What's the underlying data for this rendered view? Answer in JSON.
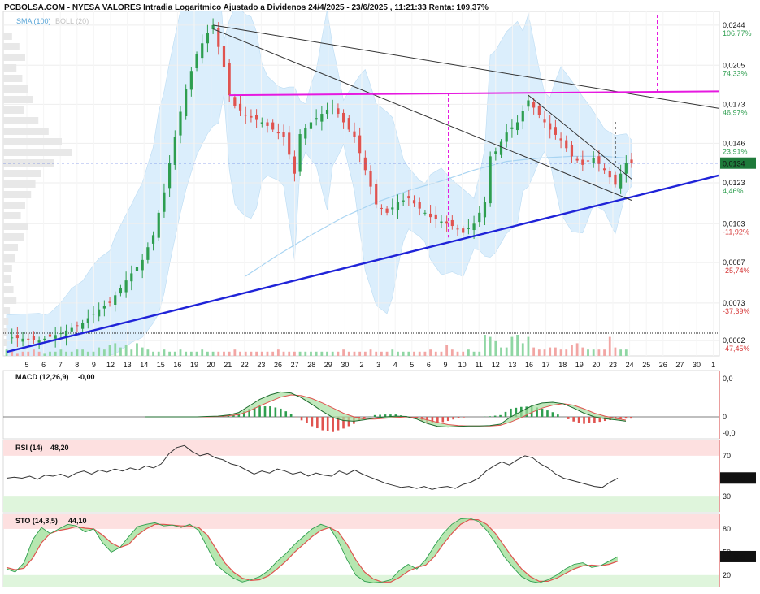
{
  "header": {
    "title": "PCBOLSA.COM - NYESA VALORES Intradia Logaritmico Ajustado a Dividenos 24/4/2025 - 23/6/2025 , 11:21:33 Renta: 109,37%",
    "indicator_sma": "SMA (100)",
    "indicator_boll": "BOLL (20)"
  },
  "colors": {
    "up": "#2e9e4f",
    "down": "#e0534f",
    "bollinger": "#cfe8fb",
    "sma": "#a8d4f2",
    "trend_blue": "#1f23d8",
    "magenta": "#e619e0",
    "last_price_box": "#1e7a3a"
  },
  "chart_data": [
    {
      "type": "line",
      "panel": "price",
      "scale": "log",
      "ylim": [
        0.0058,
        0.0259
      ],
      "y_ticks": [
        "0,0244",
        "0,0205",
        "0,0173",
        "0,0146",
        "0,0123",
        "0,0103",
        "0,0087",
        "0,0073",
        "0,0062"
      ],
      "y_tick_values": [
        0.0244,
        0.0205,
        0.0173,
        0.0146,
        0.0123,
        0.0103,
        0.0087,
        0.0073,
        0.0062
      ],
      "y_pct": [
        "106,77%",
        "74,33%",
        "46,97%",
        "23,91%",
        "4,46%",
        "-11,92%",
        "-25,74%",
        "-37,39%",
        "-47,45%"
      ],
      "last_value_label": "0,0134",
      "x_labels": [
        "5",
        "6",
        "7",
        "8",
        "9",
        "12",
        "13",
        "14",
        "15",
        "16",
        "19",
        "20",
        "21",
        "22",
        "23",
        "26",
        "27",
        "28",
        "29",
        "30",
        "2",
        "3",
        "4",
        "5",
        "6",
        "9",
        "10",
        "11",
        "12",
        "13",
        "16",
        "17",
        "18",
        "19",
        "20",
        "23",
        "24",
        "25",
        "26",
        "27",
        "30",
        "1"
      ],
      "close_path": [
        [
          0,
          0.0063
        ],
        [
          6,
          0.0062
        ],
        [
          10,
          0.0064
        ],
        [
          14,
          0.0067
        ],
        [
          17,
          0.0071
        ],
        [
          19,
          0.0073
        ],
        [
          21,
          0.0078
        ],
        [
          23,
          0.0083
        ],
        [
          25,
          0.0088
        ],
        [
          27,
          0.0098
        ],
        [
          29,
          0.0118
        ],
        [
          31,
          0.015
        ],
        [
          33,
          0.0185
        ],
        [
          35,
          0.0215
        ],
        [
          37,
          0.0236
        ],
        [
          38,
          0.0244
        ],
        [
          39,
          0.0222
        ],
        [
          40,
          0.0203
        ],
        [
          41,
          0.018
        ],
        [
          42,
          0.0172
        ],
        [
          44,
          0.0165
        ],
        [
          47,
          0.016
        ],
        [
          49,
          0.0155
        ],
        [
          51,
          0.015
        ],
        [
          53,
          0.0128
        ],
        [
          54,
          0.0152
        ],
        [
          56,
          0.016
        ],
        [
          58,
          0.0166
        ],
        [
          60,
          0.0172
        ],
        [
          62,
          0.016
        ],
        [
          64,
          0.015
        ],
        [
          66,
          0.013
        ],
        [
          68,
          0.0112
        ],
        [
          70,
          0.0108
        ],
        [
          72,
          0.0113
        ],
        [
          74,
          0.0115
        ],
        [
          76,
          0.011
        ],
        [
          78,
          0.0106
        ],
        [
          80,
          0.0104
        ],
        [
          82,
          0.0102
        ],
        [
          84,
          0.0099
        ],
        [
          86,
          0.0103
        ],
        [
          88,
          0.0113
        ],
        [
          89,
          0.0138
        ],
        [
          90,
          0.0141
        ],
        [
          92,
          0.0153
        ],
        [
          94,
          0.016
        ],
        [
          96,
          0.0176
        ],
        [
          98,
          0.0165
        ],
        [
          100,
          0.0155
        ],
        [
          102,
          0.0148
        ],
        [
          104,
          0.0138
        ],
        [
          106,
          0.0133
        ],
        [
          108,
          0.0137
        ],
        [
          110,
          0.013
        ],
        [
          112,
          0.0122
        ],
        [
          113,
          0.0128
        ],
        [
          114,
          0.0134
        ]
      ],
      "sma_100": [
        [
          44,
          0.0082
        ],
        [
          50,
          0.009
        ],
        [
          56,
          0.0098
        ],
        [
          62,
          0.0106
        ],
        [
          68,
          0.0113
        ],
        [
          74,
          0.0119
        ],
        [
          80,
          0.0124
        ],
        [
          86,
          0.013
        ],
        [
          92,
          0.0135
        ],
        [
          98,
          0.0137
        ],
        [
          104,
          0.0138
        ],
        [
          110,
          0.0138
        ],
        [
          114,
          0.0137
        ]
      ],
      "volume": [
        3,
        2,
        1,
        2,
        2,
        3,
        2,
        1,
        2,
        2,
        3,
        2,
        2,
        3,
        3,
        2,
        2,
        4,
        3,
        5,
        6,
        4,
        5,
        3,
        6,
        4,
        3,
        2,
        2,
        3,
        2,
        2,
        3,
        2,
        2,
        2,
        3,
        2,
        2,
        2,
        2,
        2,
        3,
        2,
        2,
        2,
        2,
        2,
        2,
        2,
        3,
        2,
        2,
        2,
        2,
        2,
        2,
        2,
        2,
        2,
        2,
        2,
        3,
        2,
        2,
        2,
        2,
        3,
        2,
        2,
        2,
        3,
        2,
        2,
        2,
        2,
        2,
        2,
        3,
        2,
        2,
        5,
        3,
        2,
        2,
        3,
        2,
        2,
        10,
        9,
        7,
        4,
        4,
        9,
        10,
        6,
        9,
        4,
        3,
        3,
        4,
        4,
        3,
        3,
        5,
        6,
        4,
        3,
        3,
        3,
        3,
        9,
        4,
        3,
        3
      ],
      "trendlines": [
        {
          "name": "support",
          "color": "#1f23d8",
          "from": [
            0,
            0.0059
          ],
          "to": [
            131,
            0.0127
          ]
        },
        {
          "name": "resistance",
          "color": "#333333",
          "from": [
            38,
            0.0244
          ],
          "to": [
            131,
            0.017
          ]
        },
        {
          "name": "channel-top",
          "color": "#333333",
          "from": [
            38,
            0.024
          ],
          "to": [
            115,
            0.0114
          ]
        },
        {
          "name": "channel-bottom",
          "color": "#333333",
          "from": [
            96,
            0.018
          ],
          "to": [
            115,
            0.0125
          ]
        },
        {
          "name": "horizontal-magenta",
          "color": "#e619e0",
          "from": [
            41,
            0.018
          ],
          "to": [
            131,
            0.0183
          ]
        }
      ]
    },
    {
      "type": "line",
      "panel": "macd",
      "title": "MACD (12,26,9)",
      "value": "-0,00",
      "y_ticks": [
        "0,0",
        "0",
        "-0,0"
      ],
      "macd": [
        0.0,
        0.0,
        0.0,
        0.0,
        0.0,
        0.0,
        0.01,
        0.02,
        0.05,
        0.12,
        0.3,
        0.48,
        0.6,
        0.68,
        0.65,
        0.52,
        0.34,
        0.15,
        -0.02,
        -0.1,
        -0.12,
        -0.08,
        -0.03,
        0.0,
        0.02,
        0.01,
        -0.06,
        -0.18,
        -0.26,
        -0.28,
        -0.26,
        -0.25,
        -0.25,
        -0.24,
        -0.2,
        0.0,
        0.15,
        0.3,
        0.38,
        0.4,
        0.36,
        0.24,
        0.1,
        0.0,
        -0.05,
        -0.08,
        -0.12
      ],
      "signal": [
        0.0,
        0.0,
        0.0,
        0.0,
        0.0,
        0.0,
        0.0,
        0.01,
        0.03,
        0.06,
        0.16,
        0.3,
        0.42,
        0.54,
        0.6,
        0.58,
        0.5,
        0.38,
        0.24,
        0.1,
        0.0,
        -0.06,
        -0.06,
        -0.04,
        -0.02,
        0.0,
        -0.02,
        -0.08,
        -0.15,
        -0.21,
        -0.24,
        -0.25,
        -0.25,
        -0.25,
        -0.23,
        -0.14,
        -0.02,
        0.12,
        0.24,
        0.32,
        0.36,
        0.32,
        0.22,
        0.1,
        0.02,
        -0.04,
        -0.09
      ]
    },
    {
      "type": "line",
      "panel": "rsi",
      "title": "RSI (14)",
      "value": "48,20",
      "last_value_label": "48,200",
      "y_ticks": [
        "70",
        "30"
      ],
      "ylim": [
        15,
        85
      ],
      "values": [
        48,
        49,
        48,
        50,
        47,
        51,
        50,
        52,
        49,
        53,
        55,
        52,
        56,
        54,
        57,
        55,
        58,
        56,
        60,
        58,
        62,
        72,
        78,
        80,
        74,
        70,
        72,
        68,
        66,
        62,
        60,
        56,
        52,
        55,
        53,
        57,
        55,
        52,
        54,
        50,
        53,
        51,
        50,
        55,
        52,
        56,
        52,
        49,
        46,
        43,
        41,
        39,
        40,
        38,
        40,
        37,
        39,
        40,
        38,
        42,
        44,
        48,
        55,
        60,
        64,
        61,
        66,
        70,
        68,
        62,
        58,
        52,
        48,
        46,
        44,
        42,
        40,
        39,
        44,
        48
      ]
    },
    {
      "type": "line",
      "panel": "stochastic",
      "title": "STO (14,3,5)",
      "value": "44,10",
      "last_value_label": "44,103",
      "y_ticks": [
        "80",
        "50",
        "20"
      ],
      "ylim": [
        5,
        100
      ],
      "k": [
        28,
        24,
        36,
        66,
        82,
        74,
        80,
        86,
        84,
        76,
        80,
        62,
        50,
        56,
        70,
        83,
        86,
        88,
        84,
        85,
        82,
        86,
        78,
        56,
        34,
        24,
        16,
        11,
        14,
        18,
        26,
        38,
        48,
        60,
        70,
        80,
        86,
        82,
        64,
        40,
        20,
        12,
        10,
        11,
        14,
        26,
        34,
        28,
        40,
        58,
        74,
        86,
        93,
        94,
        90,
        78,
        62,
        44,
        30,
        18,
        12,
        10,
        14,
        20,
        28,
        34,
        36,
        30,
        32,
        38,
        44
      ],
      "d": [
        30,
        27,
        29,
        42,
        62,
        74,
        78,
        80,
        83,
        81,
        80,
        72,
        62,
        56,
        60,
        72,
        80,
        86,
        86,
        85,
        84,
        84,
        82,
        72,
        54,
        36,
        24,
        16,
        13,
        14,
        19,
        28,
        38,
        50,
        60,
        70,
        78,
        82,
        76,
        60,
        40,
        24,
        15,
        11,
        11,
        17,
        25,
        30,
        33,
        44,
        60,
        74,
        86,
        92,
        92,
        86,
        74,
        58,
        42,
        28,
        18,
        12,
        12,
        16,
        22,
        28,
        32,
        33,
        32,
        34,
        38
      ]
    }
  ]
}
